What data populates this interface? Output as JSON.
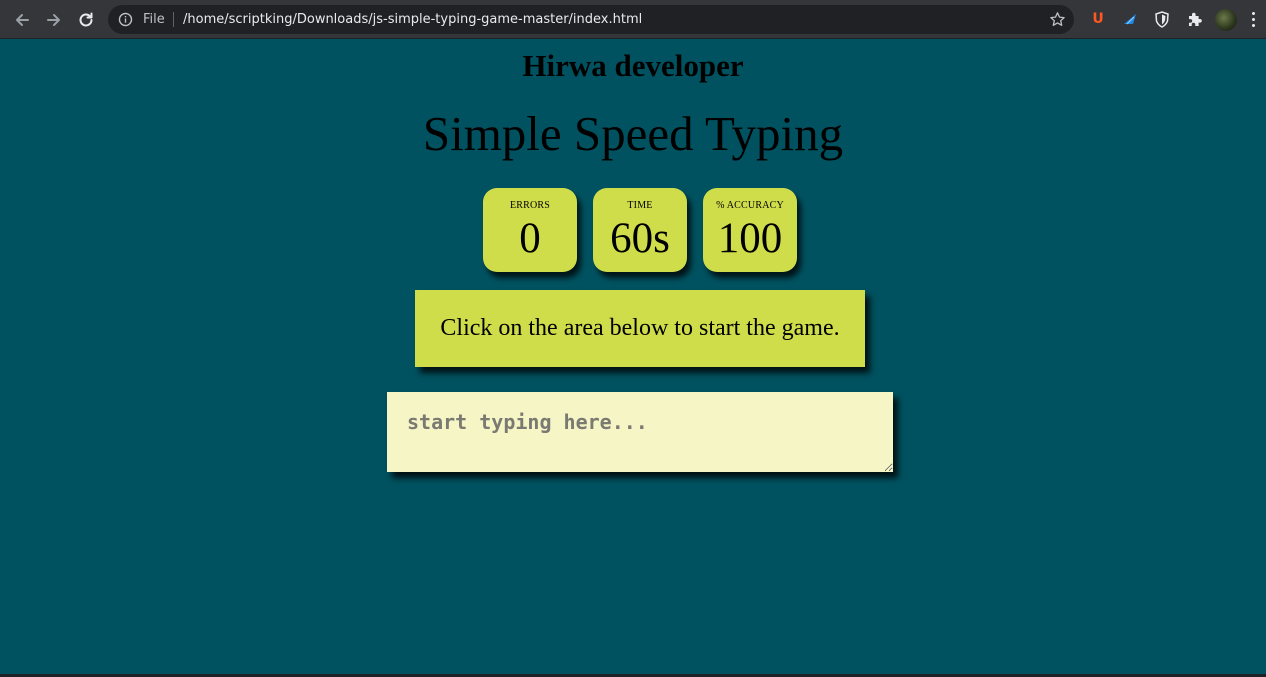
{
  "browser": {
    "scheme_label": "File",
    "url": "/home/scriptking/Downloads/js-simple-typing-game-master/index.html",
    "icons": {
      "back": "arrow-left-icon",
      "forward": "arrow-right-icon",
      "reload": "reload-icon",
      "info": "info-icon",
      "bookmark": "star-icon",
      "extensions": [
        "ublock-icon",
        "bird-extension-icon",
        "shield-extension-icon",
        "puzzle-extensions-icon"
      ],
      "menu": "more-vertical-icon"
    },
    "extension_u_label": "U"
  },
  "page": {
    "author": "Hirwa developer",
    "title": "Simple Speed Typing",
    "stats": [
      {
        "label": "ERRORS",
        "value": "0"
      },
      {
        "label": "TIME",
        "value": "60s"
      },
      {
        "label": "% ACCURACY",
        "value": "100"
      }
    ],
    "quote": "Click on the area below to start the game.",
    "input": {
      "placeholder": "start typing here...",
      "value": ""
    }
  },
  "colors": {
    "background": "#015260",
    "accent": "#cfdd4a",
    "input_background": "#f5f5c6",
    "browser_chrome": "#35363a"
  }
}
